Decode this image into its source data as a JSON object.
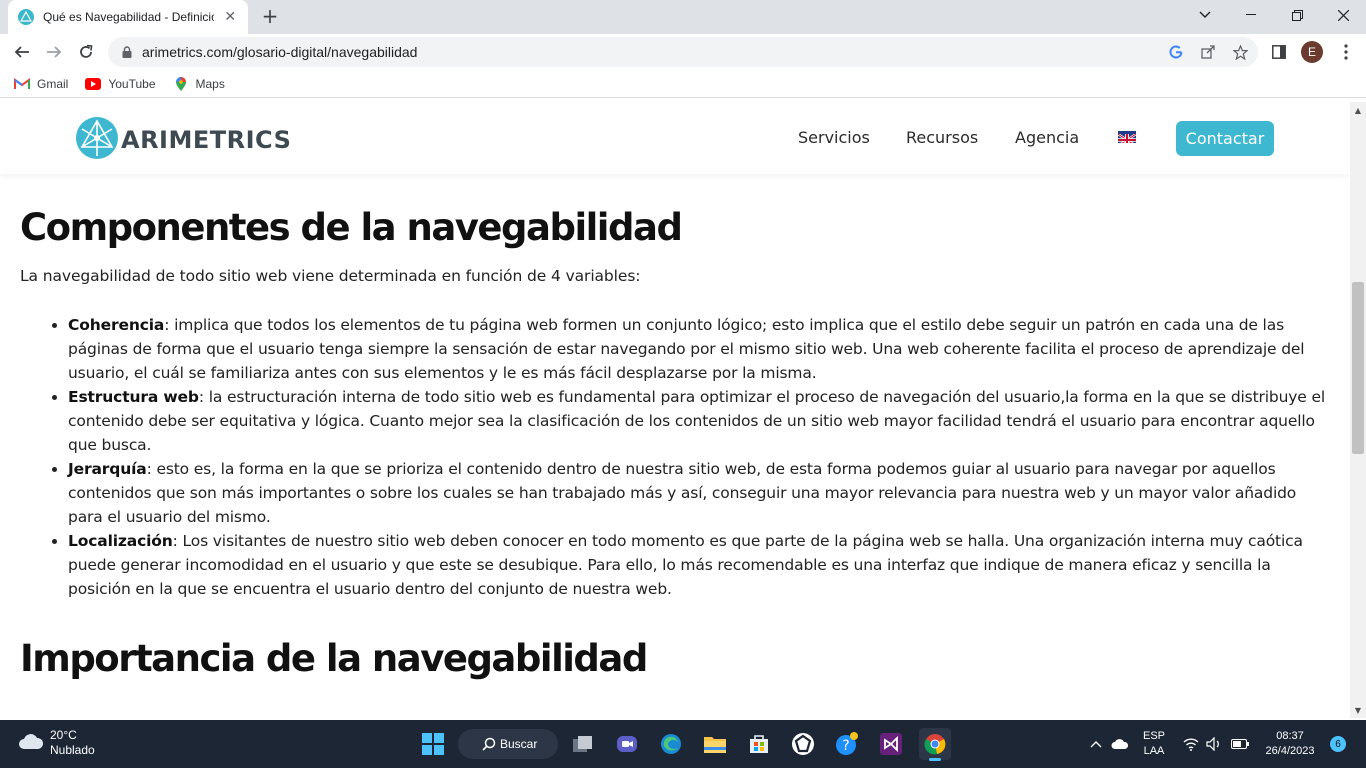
{
  "browser": {
    "tab_title": "Qué es Navegabilidad - Definición",
    "tab_close": "✕",
    "new_tab": "+",
    "url": "arimetrics.com/glosario-digital/navegabilidad",
    "profile_initial": "E",
    "bookmarks": [
      {
        "label": "Gmail",
        "icon": "gmail-icon"
      },
      {
        "label": "YouTube",
        "icon": "youtube-icon"
      },
      {
        "label": "Maps",
        "icon": "maps-icon"
      }
    ]
  },
  "site": {
    "logo_text": "ARIMETRICS",
    "nav": [
      "Servicios",
      "Recursos",
      "Agencia"
    ],
    "flag_icon": "uk-flag-icon",
    "contact_label": "Contactar",
    "accent_color": "#3db8d0"
  },
  "article": {
    "heading1": "Componentes de la navegabilidad",
    "intro": "La navegabilidad de todo sitio web viene determinada en función de 4 variables:",
    "items": [
      {
        "term": "Coherencia",
        "text": ": implica que todos los elementos de tu página web formen un conjunto lógico; esto implica que el estilo debe seguir un patrón en cada una de las páginas de forma que el usuario tenga siempre la sensación de estar navegando por el mismo sitio web. Una web coherente facilita el proceso de aprendizaje del usuario, el cuál se familiariza antes con sus elementos y le es más fácil desplazarse por la misma."
      },
      {
        "term": "Estructura web",
        "text": ": la estructuración interna de todo sitio web es fundamental para optimizar el proceso de navegación del usuario,la forma en la que se distribuye el contenido debe ser equitativa y lógica. Cuanto mejor sea la clasificación de los contenidos de un sitio web mayor facilidad tendrá el usuario para encontrar aquello que busca."
      },
      {
        "term": "Jerarquía",
        "text": ": esto es, la forma en la que se prioriza el contenido dentro de nuestra sitio web, de esta forma podemos guiar al usuario para navegar por aquellos contenidos que son más importantes o sobre los cuales se han trabajado más y así, conseguir una mayor relevancia para nuestra web y un mayor valor añadido para el usuario del mismo."
      },
      {
        "term": "Localización",
        "text": ": Los visitantes de nuestro sitio web deben conocer en todo momento es que parte de la página web se halla. Una organización interna muy caótica puede generar incomodidad en el usuario y que este se desubique. Para ello, lo más recomendable es una interfaz que indique de manera eficaz y sencilla la posición en la que se encuentra el usuario dentro del conjunto de nuestra web."
      }
    ],
    "heading2": "Importancia de la navegabilidad"
  },
  "taskbar": {
    "temperature": "20°C",
    "weather": "Nublado",
    "search_label": "Buscar",
    "language": "ESP",
    "layout": "LAA",
    "time": "08:37",
    "date": "26/4/2023",
    "notifications": "6"
  }
}
